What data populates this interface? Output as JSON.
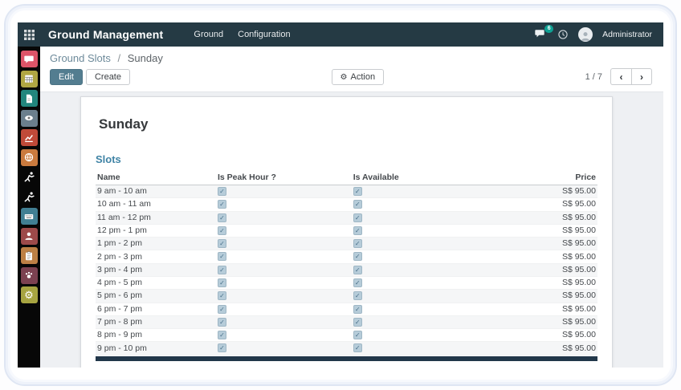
{
  "topbar": {
    "title": "Ground Management",
    "menu_items": [
      "Ground",
      "Configuration"
    ],
    "message_badge": "6",
    "user": "Administrator",
    "bg_color": "#253a44",
    "badge_color": "#0fa294"
  },
  "control_panel": {
    "breadcrumb_parent": "Ground Slots",
    "breadcrumb_separator": "/",
    "breadcrumb_current": "Sunday",
    "edit_label": "Edit",
    "create_label": "Create",
    "action_label": "Action",
    "action_gear": "⚙",
    "pager_value": "1 / 7",
    "pager_prev": "‹",
    "pager_next": "›",
    "primary_button_color": "#537d90"
  },
  "sheet": {
    "title": "Sunday",
    "section_label": "Slots",
    "section_color": "#3f83a5"
  },
  "table": {
    "headers": {
      "name": "Name",
      "peak": "Is Peak Hour ?",
      "available": "Is Available",
      "price": "Price"
    },
    "checkbox_check": "✓",
    "rows": [
      {
        "name": "9 am - 10 am",
        "peak": true,
        "available": true,
        "price": "S$ 95.00"
      },
      {
        "name": "10 am - 11 am",
        "peak": true,
        "available": true,
        "price": "S$ 95.00"
      },
      {
        "name": "11 am - 12 pm",
        "peak": true,
        "available": true,
        "price": "S$ 95.00"
      },
      {
        "name": "12 pm - 1 pm",
        "peak": true,
        "available": true,
        "price": "S$ 95.00"
      },
      {
        "name": "1 pm - 2 pm",
        "peak": true,
        "available": true,
        "price": "S$ 95.00"
      },
      {
        "name": "2 pm - 3 pm",
        "peak": true,
        "available": true,
        "price": "S$ 95.00"
      },
      {
        "name": "3 pm - 4 pm",
        "peak": true,
        "available": true,
        "price": "S$ 95.00"
      },
      {
        "name": "4 pm - 5 pm",
        "peak": true,
        "available": true,
        "price": "S$ 95.00"
      },
      {
        "name": "5 pm - 6 pm",
        "peak": true,
        "available": true,
        "price": "S$ 95.00"
      },
      {
        "name": "6 pm - 7 pm",
        "peak": true,
        "available": true,
        "price": "S$ 95.00"
      },
      {
        "name": "7 pm - 8 pm",
        "peak": true,
        "available": true,
        "price": "S$ 95.00"
      },
      {
        "name": "8 pm - 9 pm",
        "peak": true,
        "available": true,
        "price": "S$ 95.00"
      },
      {
        "name": "9 pm - 10 pm",
        "peak": true,
        "available": true,
        "price": "S$ 95.00"
      }
    ]
  },
  "sidebar": {
    "items": [
      {
        "icon": "chat",
        "color": "#dd5468"
      },
      {
        "icon": "calendar",
        "color": "#b0a643"
      },
      {
        "icon": "document",
        "color": "#22867d"
      },
      {
        "icon": "eye",
        "color": "#6b7f8d"
      },
      {
        "icon": "chart",
        "color": "#c04a39"
      },
      {
        "icon": "globe",
        "color": "#ca7a3e"
      },
      {
        "icon": "athlete",
        "color": "transparent"
      },
      {
        "icon": "athlete",
        "color": "transparent"
      },
      {
        "icon": "keyboard",
        "color": "#417f93"
      },
      {
        "icon": "member",
        "color": "#9d4a4a"
      },
      {
        "icon": "clipboard",
        "color": "#bd8045"
      },
      {
        "icon": "paw",
        "color": "#7c4150"
      },
      {
        "icon": "gear",
        "color": "#a7a441"
      }
    ]
  }
}
